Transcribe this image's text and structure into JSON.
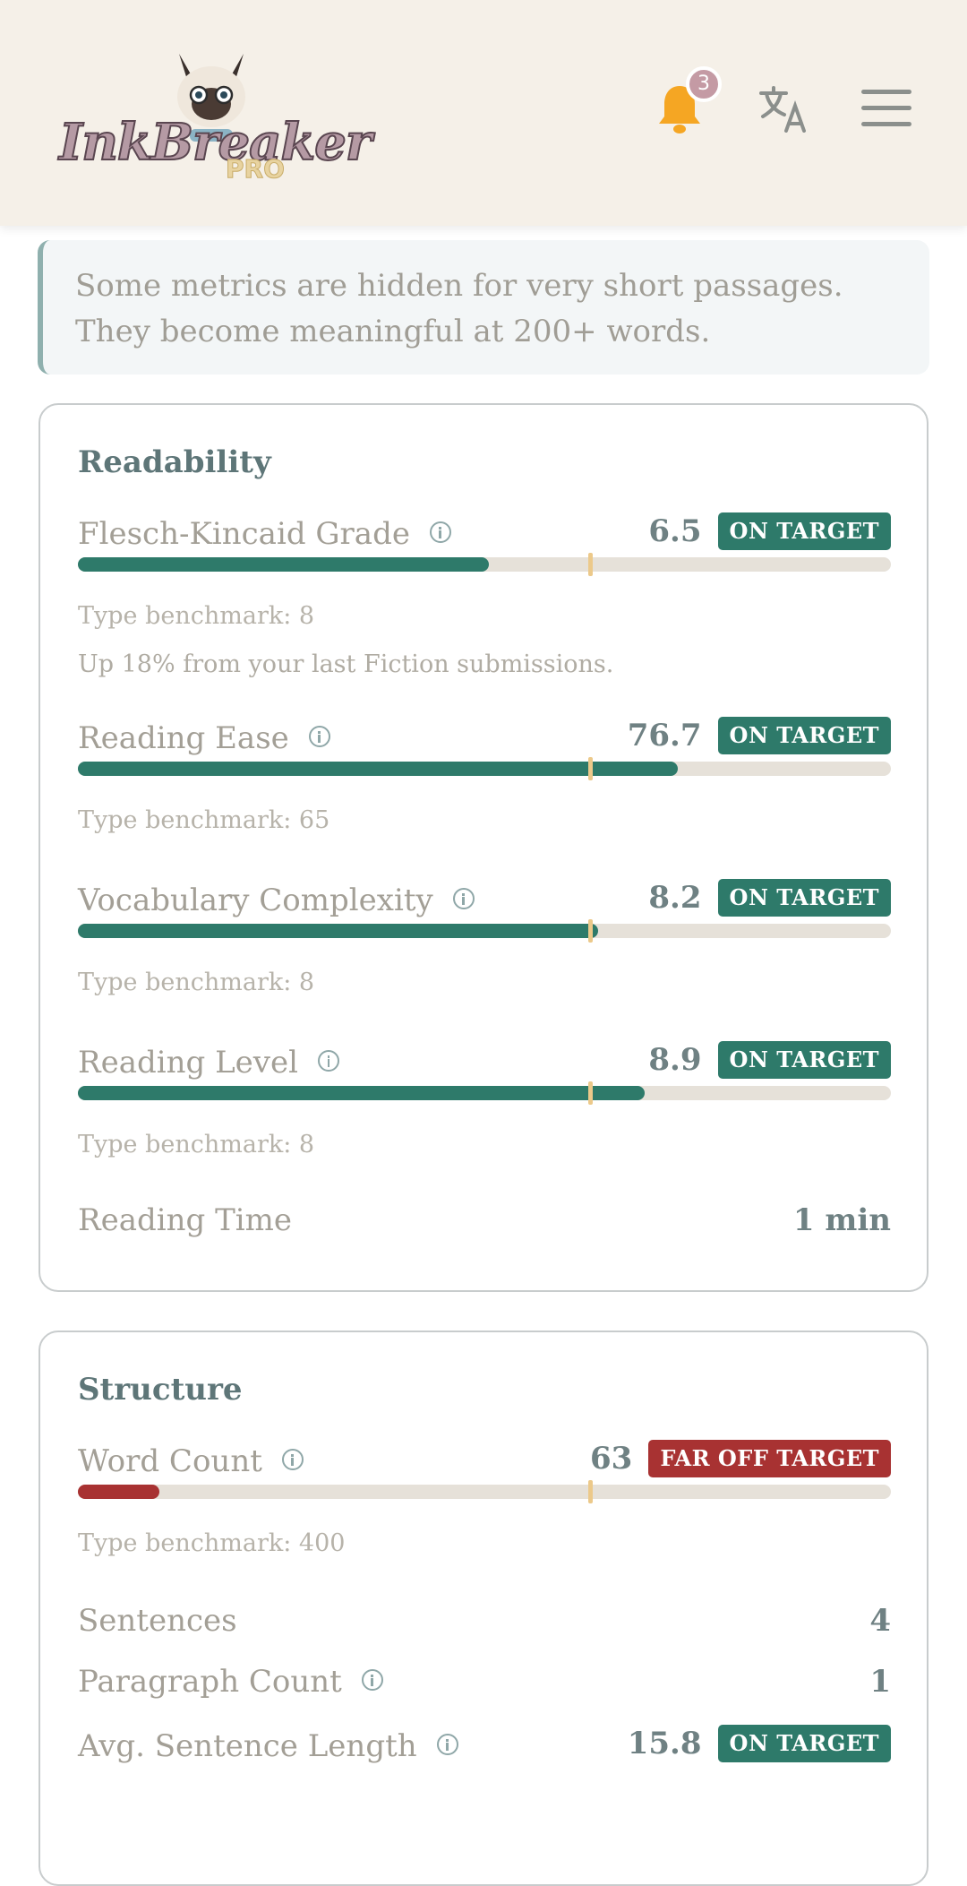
{
  "header": {
    "logo_text": "InkBreaker",
    "logo_badge": "PRO",
    "notification_count": "3",
    "icons": [
      "bell-icon",
      "translate-icon",
      "hamburger-menu-icon"
    ],
    "colors": {
      "background": "#f5f0e8",
      "bell": "#f5a623",
      "badge": "#c49aa4"
    }
  },
  "notice": {
    "text": "Some metrics are hidden for very short passages. They become meaningful at 200+ words."
  },
  "readability": {
    "title": "Readability",
    "metrics": [
      {
        "label": "Flesch-Kincaid Grade",
        "value": "6.5",
        "status": "ON TARGET",
        "fill_fraction": 0.505,
        "benchmark_fraction": 0.63,
        "benchmark": "Type benchmark: 8",
        "note": "Up 18% from your last Fiction submissions."
      },
      {
        "label": "Reading Ease",
        "value": "76.7",
        "status": "ON TARGET",
        "fill_fraction": 0.738,
        "benchmark_fraction": 0.63,
        "benchmark": "Type benchmark: 65"
      },
      {
        "label": "Vocabulary Complexity",
        "value": "8.2",
        "status": "ON TARGET",
        "fill_fraction": 0.64,
        "benchmark_fraction": 0.63,
        "benchmark": "Type benchmark: 8"
      },
      {
        "label": "Reading Level",
        "value": "8.9",
        "status": "ON TARGET",
        "fill_fraction": 0.697,
        "benchmark_fraction": 0.63,
        "benchmark": "Type benchmark: 8"
      }
    ],
    "reading_time": {
      "label": "Reading Time",
      "value": "1 min"
    }
  },
  "structure": {
    "title": "Structure",
    "word_count": {
      "label": "Word Count",
      "value": "63",
      "status": "FAR OFF TARGET",
      "fill_fraction": 0.1,
      "benchmark_fraction": 0.63,
      "benchmark": "Type benchmark: 400"
    },
    "sentences": {
      "label": "Sentences",
      "value": "4"
    },
    "paragraph_count": {
      "label": "Paragraph Count",
      "value": "1"
    },
    "avg_sentence_length": {
      "label": "Avg. Sentence Length",
      "value": "15.8",
      "status": "ON TARGET"
    }
  },
  "colors": {
    "on_target": "#2e7a6a",
    "far_off_target": "#a83232",
    "benchmark_marker": "#ecc98a",
    "track": "#e6e1d9"
  }
}
